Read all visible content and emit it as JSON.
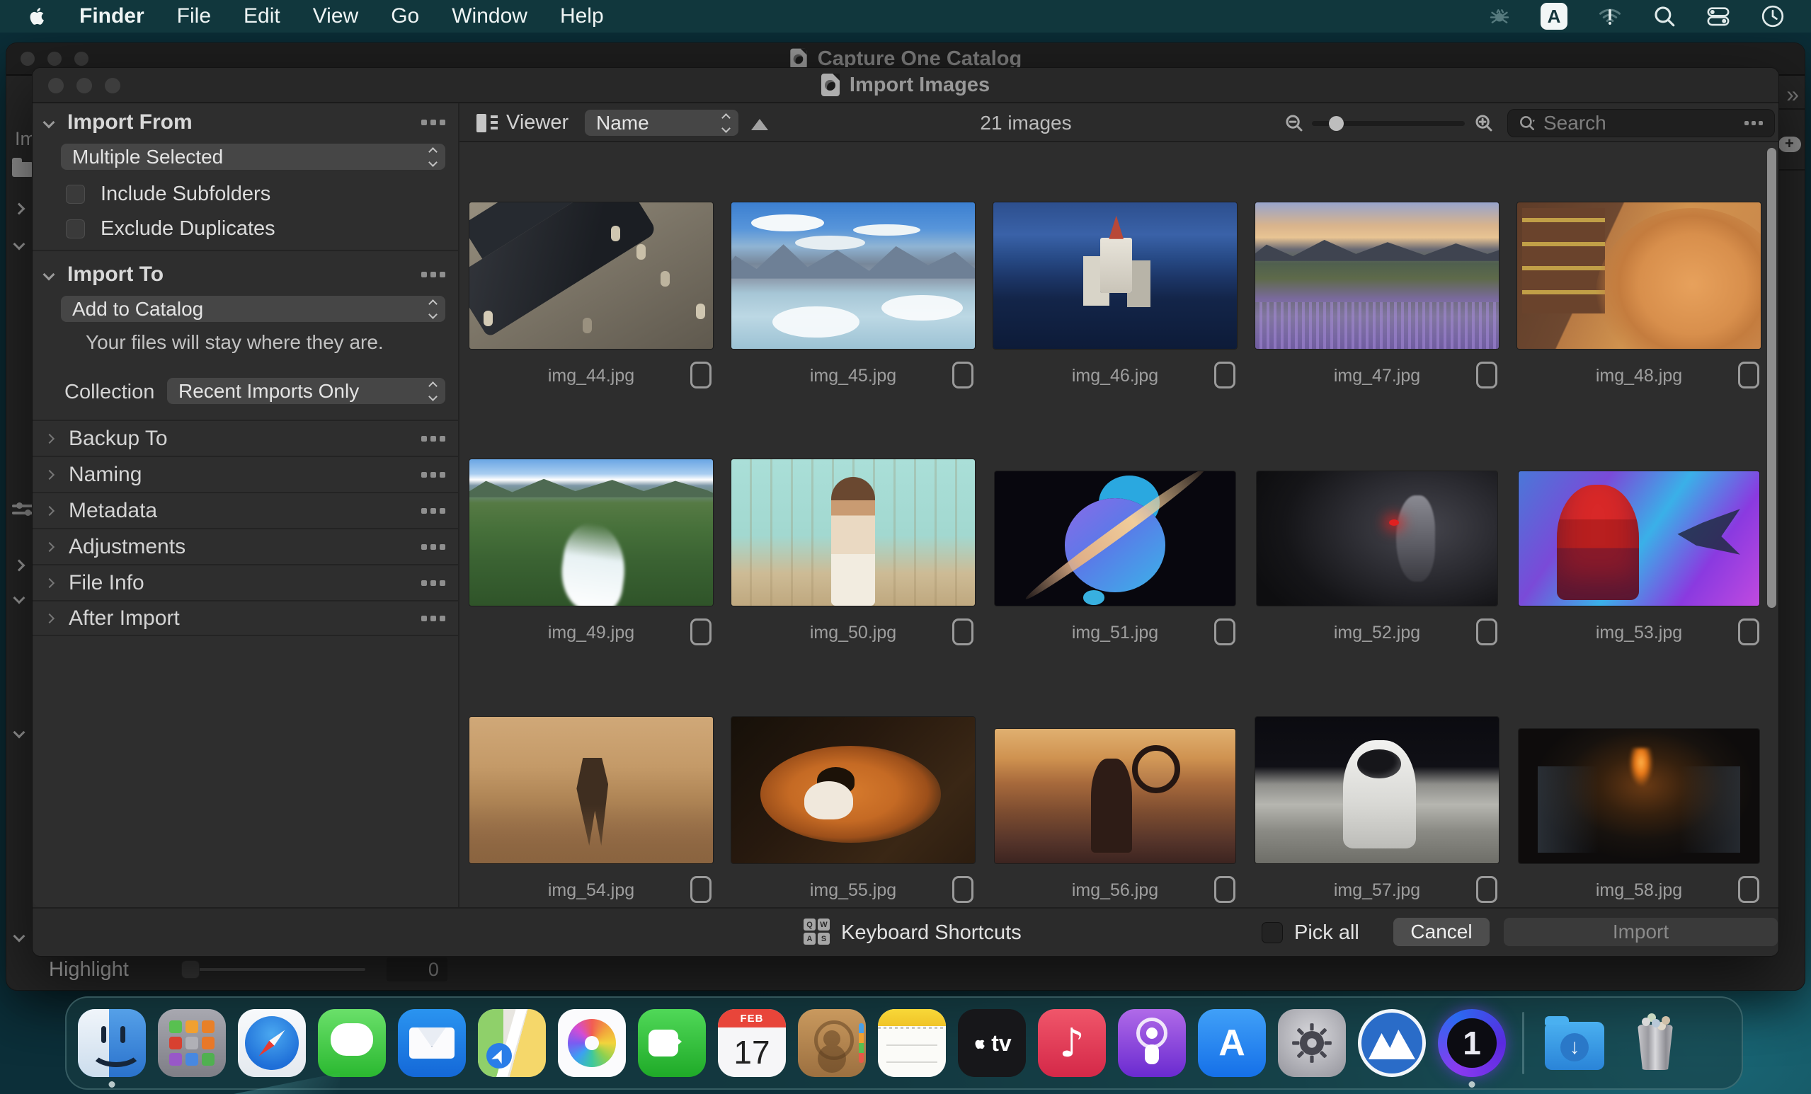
{
  "menu_bar": {
    "items": [
      {
        "label": "Finder",
        "weight": "bold"
      },
      {
        "label": "File"
      },
      {
        "label": "Edit"
      },
      {
        "label": "View"
      },
      {
        "label": "Go"
      },
      {
        "label": "Window"
      },
      {
        "label": "Help"
      }
    ],
    "input_source_glyph": "A"
  },
  "catalog_window": {
    "title": "Capture One Catalog",
    "highlight": {
      "label": "Highlight",
      "value": "0"
    }
  },
  "import_window": {
    "title": "Import Images",
    "sidebar": {
      "import_from": {
        "title": "Import From",
        "selected": "Multiple Selected",
        "options": [
          {
            "label": "Include Subfolders"
          },
          {
            "label": "Exclude Duplicates"
          }
        ]
      },
      "import_to": {
        "title": "Import To",
        "selected": "Add to Catalog",
        "note": "Your files will stay where they are.",
        "collection_label": "Collection",
        "collection_selected": "Recent Imports Only"
      },
      "collapsed_sections": [
        {
          "label": "Backup To"
        },
        {
          "label": "Naming"
        },
        {
          "label": "Metadata"
        },
        {
          "label": "Adjustments"
        },
        {
          "label": "File Info"
        },
        {
          "label": "After Import"
        }
      ]
    },
    "toolbar": {
      "viewer_label": "Viewer",
      "sort_by": "Name",
      "count": "21 images",
      "search_placeholder": "Search"
    },
    "grid": {
      "rows": [
        {
          "items": [
            {
              "filename": "img_44.jpg",
              "thumb": "t44"
            },
            {
              "filename": "img_45.jpg",
              "thumb": "t45"
            },
            {
              "filename": "img_46.jpg",
              "thumb": "t46"
            },
            {
              "filename": "img_47.jpg",
              "thumb": "t47"
            },
            {
              "filename": "img_48.jpg",
              "thumb": "t48"
            }
          ]
        },
        {
          "items": [
            {
              "filename": "img_49.jpg",
              "thumb": "t49"
            },
            {
              "filename": "img_50.jpg",
              "thumb": "t50"
            },
            {
              "filename": "img_51.jpg",
              "thumb": "t51",
              "size": "short"
            },
            {
              "filename": "img_52.jpg",
              "thumb": "t52",
              "size": "short"
            },
            {
              "filename": "img_53.jpg",
              "thumb": "t53",
              "size": "short"
            }
          ]
        },
        {
          "items": [
            {
              "filename": "img_54.jpg",
              "thumb": "t54"
            },
            {
              "filename": "img_55.jpg",
              "thumb": "t55"
            },
            {
              "filename": "img_56.jpg",
              "thumb": "t56",
              "size": "short"
            },
            {
              "filename": "img_57.jpg",
              "thumb": "t57"
            },
            {
              "filename": "img_58.jpg",
              "thumb": "t58",
              "size": "short"
            }
          ]
        }
      ]
    },
    "footer": {
      "shortcuts_label": "Keyboard Shortcuts",
      "key_letters": [
        {
          "k": "Q"
        },
        {
          "k": "W"
        },
        {
          "k": "A"
        },
        {
          "k": "S"
        }
      ],
      "pick_all_label": "Pick all",
      "cancel_label": "Cancel",
      "import_label": "Import"
    }
  },
  "dock": {
    "calendar_month": "FEB",
    "calendar_day": "17",
    "tv_label": "tv",
    "music_glyph": "♪",
    "appstore_glyph": "A",
    "capture_one_glyph": "1",
    "downloads_glyph": "↓"
  },
  "colors": {
    "desktop_teal": "#124651",
    "window_bg": "#2c2c2c",
    "sidebar_bg": "#2e2e2e",
    "dropdown_bg": "#464646",
    "disabled_text": "#8a8a8a"
  }
}
